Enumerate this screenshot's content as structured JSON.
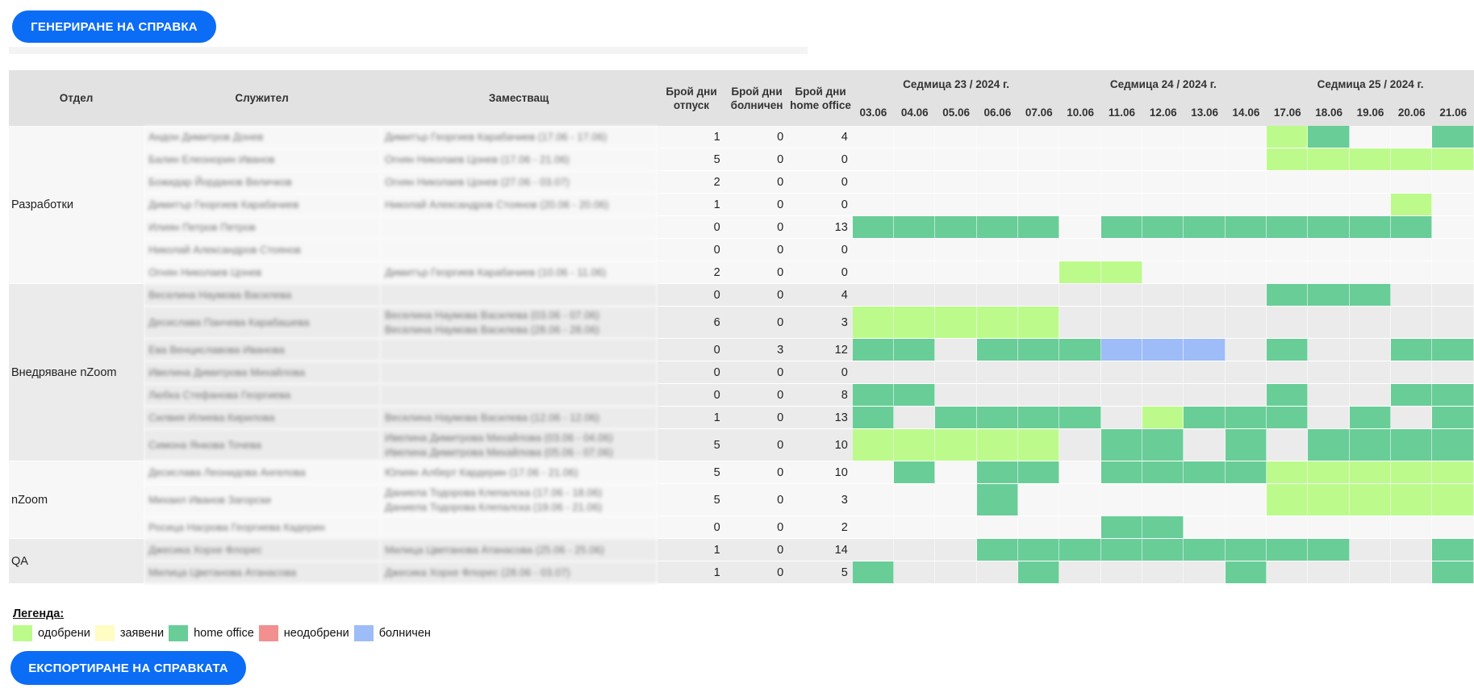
{
  "buttons": {
    "generate": "ГЕНЕРИРАНЕ НА СПРАВКА",
    "export": "ЕКСПОРТИРАНЕ НА СПРАВКАТА"
  },
  "headers": {
    "dept": "Отдел",
    "employee": "Служител",
    "substitute": "Заместващ",
    "vac": "Брой дни отпуск",
    "sick": "Брой дни болничен",
    "ho": "Брой дни home office"
  },
  "weeks": [
    "Седмица 23 / 2024 г.",
    "Седмица 24 / 2024 г.",
    "Седмица 25 / 2024 г."
  ],
  "days": [
    "03.06",
    "04.06",
    "05.06",
    "06.06",
    "07.06",
    "10.06",
    "11.06",
    "12.06",
    "13.06",
    "14.06",
    "17.06",
    "18.06",
    "19.06",
    "20.06",
    "21.06"
  ],
  "legend": {
    "title": "Легенда:",
    "items": [
      {
        "key": "a",
        "label": "одобрени",
        "color": "#bcfb8b"
      },
      {
        "key": "p",
        "label": "заявени",
        "color": "#fffcc4"
      },
      {
        "key": "h",
        "label": "home office",
        "color": "#69cd98"
      },
      {
        "key": "d",
        "label": "неодобрени",
        "color": "#f28f8f"
      },
      {
        "key": "s",
        "label": "болничен",
        "color": "#9dbcf8"
      }
    ]
  },
  "departments": [
    {
      "name": "Разработки",
      "rows": [
        {
          "employee": "Андон Димитров Донев",
          "substitute": [
            "Димитър Георгиев Карабачиев (17.06 - 17.06)"
          ],
          "vac": "1",
          "sick": "0",
          "ho": "4",
          "cells": "..........ah..h"
        },
        {
          "employee": "Балин Елеонорин Иванов",
          "substitute": [
            "Огнян Николаев Цонев (17.06 - 21.06)"
          ],
          "vac": "5",
          "sick": "0",
          "ho": "0",
          "cells": "..........aaaaa"
        },
        {
          "employee": "Божидар Йорданов Величков",
          "substitute": [
            "Огнян Николаев Цонев (27.06 - 03.07)"
          ],
          "vac": "2",
          "sick": "0",
          "ho": "0",
          "cells": "..............."
        },
        {
          "employee": "Димитър Георгиев Карабачиев",
          "substitute": [
            "Николай Александров Стоянов (20.06 - 20.06)"
          ],
          "vac": "1",
          "sick": "0",
          "ho": "0",
          "cells": ".............a."
        },
        {
          "employee": "Илиян Петров Петров",
          "substitute": [],
          "vac": "0",
          "sick": "0",
          "ho": "13",
          "cells": "hhhhh.hhhhhhhh."
        },
        {
          "employee": "Николай Александров Стоянов",
          "substitute": [],
          "vac": "0",
          "sick": "0",
          "ho": "0",
          "cells": "..............."
        },
        {
          "employee": "Огнян Николаев Цонев",
          "substitute": [
            "Димитър Георгиев Карабачиев (10.06 - 11.06)"
          ],
          "vac": "2",
          "sick": "0",
          "ho": "0",
          "cells": ".....aa........"
        }
      ]
    },
    {
      "name": "Внедряване nZoom",
      "rows": [
        {
          "employee": "Веселина Наумова Василева",
          "substitute": [],
          "vac": "0",
          "sick": "0",
          "ho": "4",
          "cells": "..........hhh.."
        },
        {
          "employee": "Десислава Панчева Карабашева",
          "substitute": [
            "Веселина Наумова Василева (03.06 - 07.06)",
            "Веселина Наумова Василева (28.06 - 28.06)"
          ],
          "vac": "6",
          "sick": "0",
          "ho": "3",
          "cells": "aaaaa.........."
        },
        {
          "employee": "Ева Венциславова Иванова",
          "substitute": [],
          "vac": "0",
          "sick": "3",
          "ho": "12",
          "cells": "hh.hhhsss.h..hh"
        },
        {
          "employee": "Ивелина Димитрова Михайлова",
          "substitute": [],
          "vac": "0",
          "sick": "0",
          "ho": "0",
          "cells": "..............."
        },
        {
          "employee": "Любка Стефанова Георгиева",
          "substitute": [],
          "vac": "0",
          "sick": "0",
          "ho": "8",
          "cells": "hh........h..hh"
        },
        {
          "employee": "Силвия Илиева Кирилова",
          "substitute": [
            "Веселина Наумова Василева (12.06 - 12.06)"
          ],
          "vac": "1",
          "sick": "0",
          "ho": "13",
          "cells": "h.hhhh.ahhh.h.h"
        },
        {
          "employee": "Симона Янкова Точева",
          "substitute": [
            "Ивелина Димитрова Михайлова (03.06 - 04.06)",
            "Ивелина Димитрова Михайлова (05.06 - 07.06)"
          ],
          "vac": "5",
          "sick": "0",
          "ho": "10",
          "cells": "aaaaa.hh.h.hhhh"
        }
      ]
    },
    {
      "name": "nZoom",
      "rows": [
        {
          "employee": "Десислава Леонидова Ангелова",
          "substitute": [
            "Юлиян Алберт Кардерин (17.06 - 21.06)"
          ],
          "vac": "5",
          "sick": "0",
          "ho": "10",
          "cells": ".h.hh.hhhhaaaaa"
        },
        {
          "employee": "Михаил Иванов Загорски",
          "substitute": [
            "Даниела Тодорова Клепалска (17.06 - 18.06)",
            "Даниела Тодорова Клепалска (19.06 - 21.06)"
          ],
          "vac": "5",
          "sick": "0",
          "ho": "3",
          "cells": "...h......aaaaa"
        },
        {
          "employee": "Росица Насрова Георгиева Кадерин",
          "substitute": [],
          "vac": "0",
          "sick": "0",
          "ho": "2",
          "cells": "......hh......."
        }
      ]
    },
    {
      "name": "QA",
      "rows": [
        {
          "employee": "Джесика Хорхе Флорес",
          "substitute": [
            "Милица Цветанова Атанасова (25.06 - 25.06)"
          ],
          "vac": "1",
          "sick": "0",
          "ho": "14",
          "cells": "...hhhhhhhhh..h"
        },
        {
          "employee": "Милица Цветанова Атанасова",
          "substitute": [
            "Джесика Хорхе Флорес (28.06 - 03.07)"
          ],
          "vac": "1",
          "sick": "0",
          "ho": "5",
          "cells": "h...h....h....h"
        }
      ]
    }
  ]
}
